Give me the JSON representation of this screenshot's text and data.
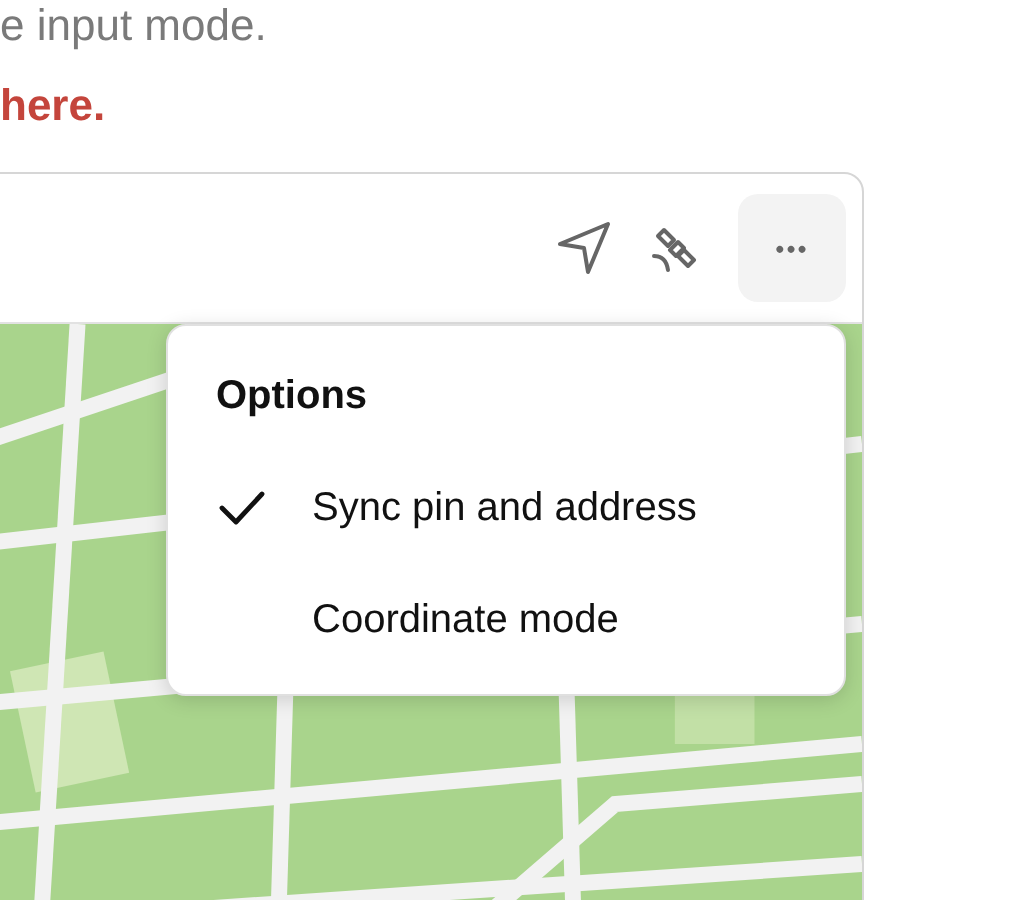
{
  "intro": {
    "text": "e input mode.",
    "link": "here."
  },
  "map_card": {
    "toolbar": {
      "more_button": {
        "label": "•••",
        "expanded": true
      }
    },
    "menu": {
      "title": "Options",
      "items": [
        {
          "label": "Sync pin and address",
          "checked": true
        },
        {
          "label": "Coordinate mode",
          "checked": false
        }
      ]
    }
  }
}
